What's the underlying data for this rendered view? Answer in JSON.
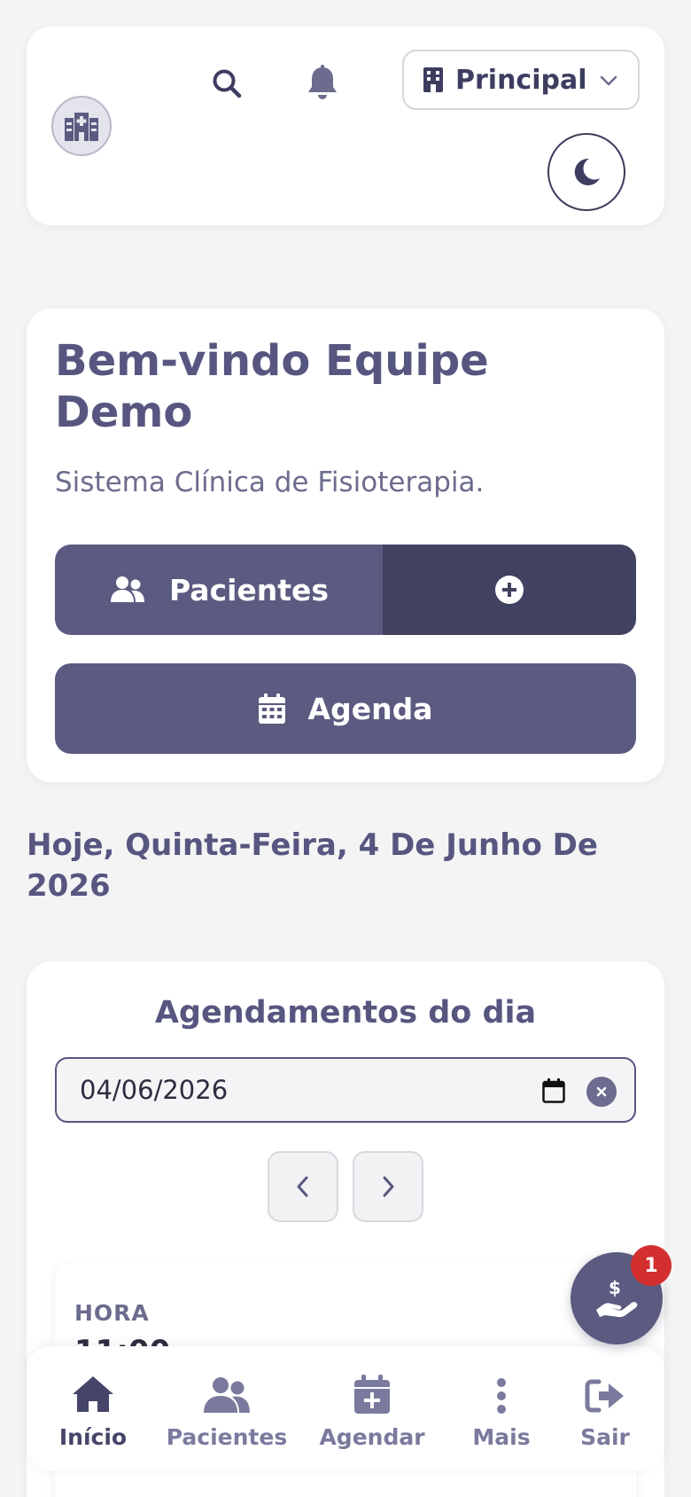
{
  "header": {
    "unit_selector": {
      "label": "Principal"
    },
    "icons": [
      "hospital-logo-icon",
      "search-icon",
      "bell-icon",
      "building-icon",
      "chevron-down-icon",
      "moon-icon"
    ]
  },
  "welcome": {
    "title": "Bem-vindo Equipe Demo",
    "subtitle": "Sistema Clínica de Fisioterapia.",
    "patients_button": "Pacientes",
    "agenda_button": "Agenda"
  },
  "today_label": "Hoje, Quinta-Feira, 4 De Junho De 2026",
  "appointments": {
    "title": "Agendamentos do dia",
    "date_value": "04/06/2026",
    "items": [
      {
        "label": "HORA",
        "time": "11:00"
      }
    ]
  },
  "fab": {
    "badge": "1",
    "icon": "hand-holding-dollar-icon"
  },
  "bottom_nav": [
    {
      "label": "Início",
      "icon": "home-icon",
      "active": true
    },
    {
      "label": "Pacientes",
      "icon": "users-icon",
      "active": false
    },
    {
      "label": "Agendar",
      "icon": "calendar-plus-icon",
      "active": false
    },
    {
      "label": "Mais",
      "icon": "more-vertical-icon",
      "active": false
    },
    {
      "label": "Sair",
      "icon": "logout-icon",
      "active": false
    }
  ],
  "colors": {
    "primary": "#5b5a80",
    "primary_dark": "#414160",
    "background": "#f4f4f5",
    "badge": "#d32f2f"
  }
}
